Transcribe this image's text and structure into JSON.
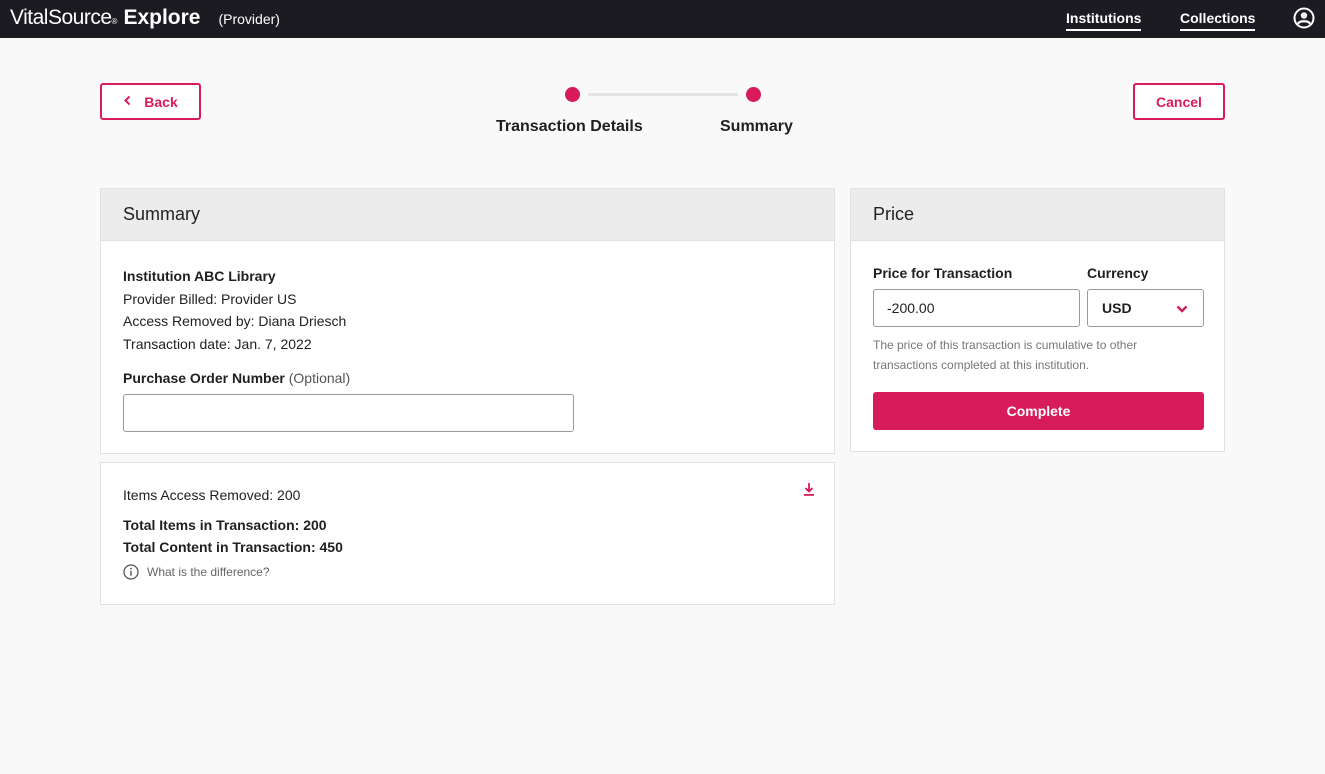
{
  "header": {
    "brand_vital": "Vital",
    "brand_source": "Source",
    "brand_reg": "®",
    "brand_explore": "Explore",
    "brand_sub": "(Provider)",
    "nav": {
      "institutions": "Institutions",
      "collections": "Collections"
    },
    "user_icon": "user-circle-icon"
  },
  "actions": {
    "back_label": "Back",
    "cancel_label": "Cancel"
  },
  "stepper": {
    "step1": "Transaction Details",
    "step2": "Summary"
  },
  "summary": {
    "title": "Summary",
    "institution": "Institution ABC Library",
    "provider_billed": "Provider Billed: Provider US",
    "access_removed_by": "Access Removed by: Diana Driesch",
    "transaction_date": "Transaction date: Jan. 7, 2022",
    "po_label": "Purchase Order Number",
    "po_optional": "(Optional)",
    "po_value": ""
  },
  "items": {
    "items_removed": "Items Access Removed: 200",
    "total_items": "Total Items in Transaction: 200",
    "total_content": "Total Content in Transaction: 450",
    "difference_link": "What is the difference?",
    "download_icon": "download-icon"
  },
  "price": {
    "title": "Price",
    "price_label": "Price for Transaction",
    "currency_label": "Currency",
    "price_value": "-200.00",
    "currency_value": "USD",
    "note": "The price of this transaction is cumulative to other transactions completed at this institution.",
    "complete_label": "Complete"
  },
  "colors": {
    "accent": "#d81b5a",
    "topbar": "#1c1b22",
    "background": "#f9f9f9"
  }
}
